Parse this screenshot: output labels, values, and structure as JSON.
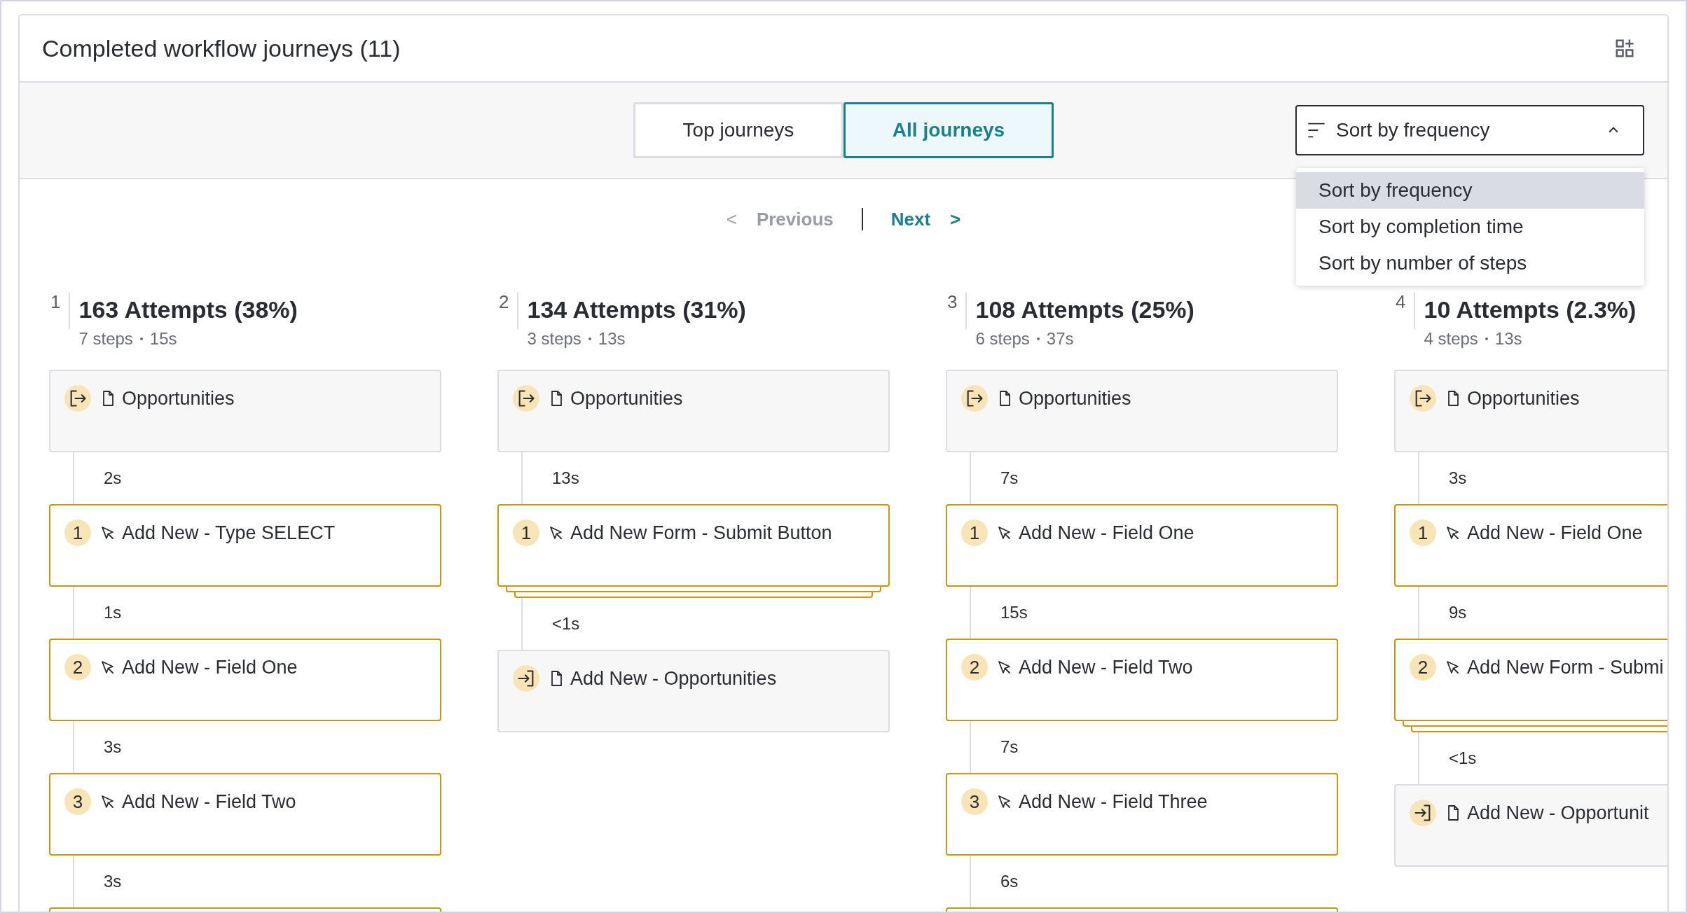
{
  "header": {
    "title": "Completed workflow journeys (11)"
  },
  "tabs": [
    {
      "label": "Top journeys",
      "selected": false
    },
    {
      "label": "All journeys",
      "selected": true
    }
  ],
  "sort": {
    "value": "Sort by frequency",
    "expanded": true,
    "options": [
      {
        "label": "Sort by frequency",
        "selected": true
      },
      {
        "label": "Sort by completion time",
        "selected": false
      },
      {
        "label": "Sort by number of steps",
        "selected": false
      }
    ]
  },
  "pagination": {
    "previous": {
      "arrow": "<",
      "label": "Previous",
      "disabled": true
    },
    "next": {
      "arrow": ">",
      "label": "Next",
      "disabled": false
    }
  },
  "journeys": [
    {
      "index": "1",
      "title": "163 Attempts (38%)",
      "steps_count": "7 steps",
      "duration": "15s",
      "steps": [
        {
          "kind": "entry",
          "label": "Opportunities"
        },
        {
          "kind": "wait",
          "text": "2s"
        },
        {
          "kind": "click",
          "badge": "1",
          "label": "Add New - Type SELECT",
          "stacked": false
        },
        {
          "kind": "wait",
          "text": "1s"
        },
        {
          "kind": "click",
          "badge": "2",
          "label": "Add New - Field One",
          "stacked": false
        },
        {
          "kind": "wait",
          "text": "3s"
        },
        {
          "kind": "click",
          "badge": "3",
          "label": "Add New - Field Two",
          "stacked": false
        },
        {
          "kind": "wait",
          "text": "3s"
        },
        {
          "kind": "cut"
        }
      ]
    },
    {
      "index": "2",
      "title": "134 Attempts (31%)",
      "steps_count": "3 steps",
      "duration": "13s",
      "steps": [
        {
          "kind": "entry",
          "label": "Opportunities"
        },
        {
          "kind": "wait",
          "text": "13s"
        },
        {
          "kind": "click",
          "badge": "1",
          "label": "Add New Form - Submit Button",
          "stacked": true
        },
        {
          "kind": "wait",
          "text": "<1s"
        },
        {
          "kind": "exit",
          "label": "Add New - Opportunities"
        }
      ]
    },
    {
      "index": "3",
      "title": "108 Attempts (25%)",
      "steps_count": "6 steps",
      "duration": "37s",
      "steps": [
        {
          "kind": "entry",
          "label": "Opportunities"
        },
        {
          "kind": "wait",
          "text": "7s"
        },
        {
          "kind": "click",
          "badge": "1",
          "label": "Add New - Field One",
          "stacked": false
        },
        {
          "kind": "wait",
          "text": "15s"
        },
        {
          "kind": "click",
          "badge": "2",
          "label": "Add New - Field Two",
          "stacked": false
        },
        {
          "kind": "wait",
          "text": "7s"
        },
        {
          "kind": "click",
          "badge": "3",
          "label": "Add New - Field Three",
          "stacked": false
        },
        {
          "kind": "wait",
          "text": "6s"
        },
        {
          "kind": "cut"
        }
      ]
    },
    {
      "index": "4",
      "title": "10 Attempts (2.3%)",
      "steps_count": "4 steps",
      "duration": "13s",
      "steps": [
        {
          "kind": "entry",
          "label": "Opportunities"
        },
        {
          "kind": "wait",
          "text": "3s"
        },
        {
          "kind": "click",
          "badge": "1",
          "label": "Add New - Field One",
          "stacked": false
        },
        {
          "kind": "wait",
          "text": "9s"
        },
        {
          "kind": "click",
          "badge": "2",
          "label": "Add New Form - Submi",
          "stacked": true
        },
        {
          "kind": "wait",
          "text": "<1s"
        },
        {
          "kind": "exit",
          "label": "Add New - Opportunit"
        }
      ]
    }
  ]
}
